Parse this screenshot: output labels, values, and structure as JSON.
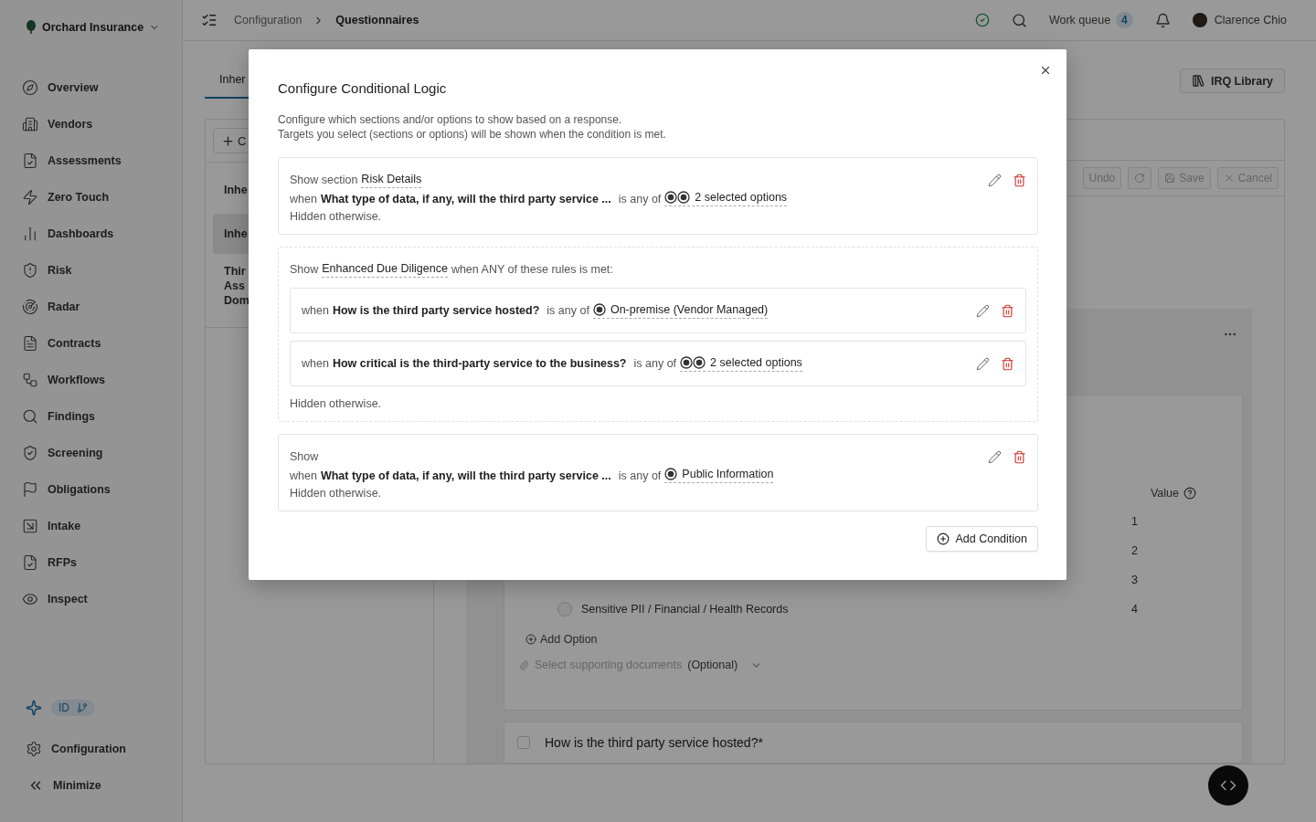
{
  "sidebar": {
    "org": "Orchard Insurance",
    "items": [
      {
        "label": "Overview"
      },
      {
        "label": "Vendors"
      },
      {
        "label": "Assessments"
      },
      {
        "label": "Zero Touch"
      },
      {
        "label": "Dashboards"
      },
      {
        "label": "Risk"
      },
      {
        "label": "Radar"
      },
      {
        "label": "Contracts"
      },
      {
        "label": "Workflows"
      },
      {
        "label": "Findings"
      },
      {
        "label": "Screening"
      },
      {
        "label": "Obligations"
      },
      {
        "label": "Intake"
      },
      {
        "label": "RFPs"
      },
      {
        "label": "Inspect"
      }
    ],
    "badge": "ID",
    "configuration": "Configuration",
    "minimize": "Minimize"
  },
  "topbar": {
    "breadcrumb": [
      "Configuration",
      "Questionnaires"
    ],
    "work_queue": "Work queue",
    "work_queue_count": "4",
    "user": "Clarence Chio"
  },
  "tabs": [
    {
      "label": "Inher",
      "selected": true
    }
  ],
  "library_button": "IRQ Library",
  "left_panel": {
    "add_button": "C",
    "items": [
      {
        "lines": [
          "Inhe"
        ],
        "selected": false
      },
      {
        "lines": [
          "Inhe"
        ],
        "selected": true
      },
      {
        "lines": [
          "Thir",
          "Ass",
          "Dom"
        ],
        "selected": false
      }
    ]
  },
  "toolbar": [
    {
      "kind": "undo",
      "label": "Undo",
      "disabled": true
    },
    {
      "kind": "redo",
      "disabled": true
    },
    {
      "kind": "save",
      "label": "Save",
      "disabled": true
    },
    {
      "kind": "cancel",
      "label": "Cancel",
      "disabled": true
    }
  ],
  "question": {
    "value_header": "Value",
    "options": [
      {
        "value": "1"
      },
      {
        "value": "2"
      },
      {
        "value": "3"
      },
      {
        "label": "Sensitive PII / Financial / Health Records",
        "value": "4",
        "selected": false
      }
    ],
    "add_option": "Add Option",
    "documents_placeholder": "Select supporting documents",
    "documents_optional": "(Optional)"
  },
  "next_question": {
    "title": "How is the third party service hosted?*",
    "checked": false
  },
  "modal": {
    "title": "Configure Conditional Logic",
    "description": [
      "Configure which sections and/or options to show based on a response.",
      "Targets you select (sections or options) will be shown when the condition is met."
    ],
    "conditions": [
      {
        "kind": "single",
        "show": "Show section",
        "target": "Risk Details",
        "rules": [
          {
            "kind": "multiple",
            "when": "when",
            "question": "What type of data, if any, will the third party service ...",
            "operator": "is any of",
            "selection": "2 selected options"
          }
        ],
        "footer": "Hidden otherwise."
      },
      {
        "kind": "group",
        "show": "Show",
        "target": "Enhanced Due Diligence",
        "match": "when ANY of these rules is met:",
        "rules": [
          {
            "kind": "single",
            "when": "when",
            "question": "How is the third party service hosted?",
            "operator": "is any of",
            "selection": "On-premise (Vendor Managed)"
          },
          {
            "kind": "multiple",
            "when": "when",
            "question": "How critical is the third-party service to the business?",
            "operator": "is any of",
            "selection": "2 selected options"
          }
        ],
        "footer": "Hidden otherwise."
      },
      {
        "kind": "single",
        "show": "Show",
        "rules": [
          {
            "kind": "single",
            "when": "when",
            "question": "What type of data, if any, will the third party service ...",
            "operator": "is any of",
            "selection": "Public Information"
          }
        ],
        "footer": "Hidden otherwise."
      }
    ],
    "add_button": "Add Condition"
  }
}
